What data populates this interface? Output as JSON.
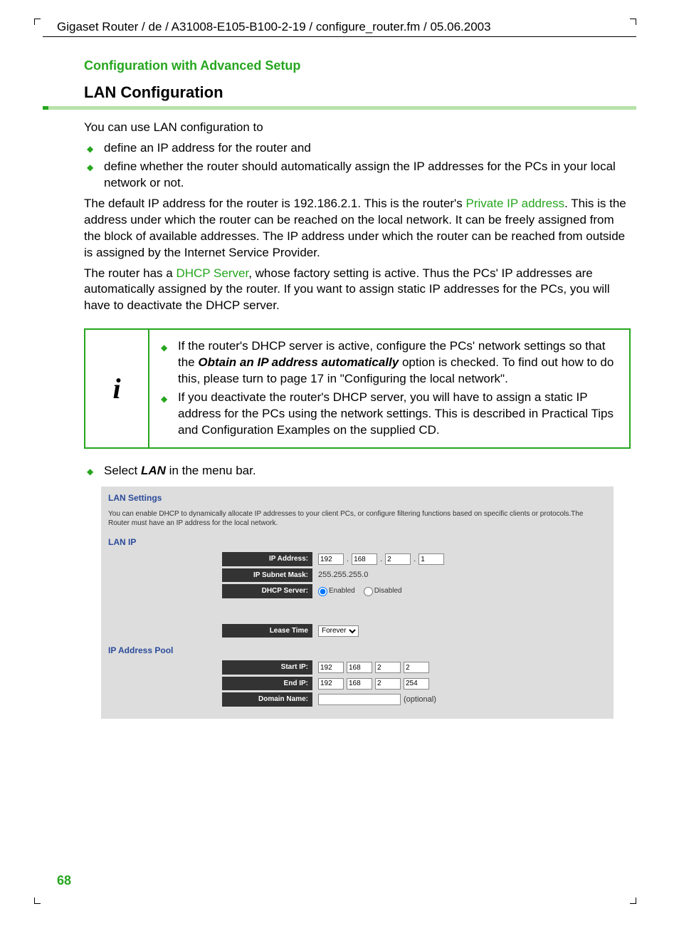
{
  "header_path": "Gigaset Router / de / A31008-E105-B100-2-19 / configure_router.fm / 05.06.2003",
  "chapter": "Configuration with Advanced Setup",
  "section_title": "LAN Configuration",
  "intro": "You can use LAN configuration to",
  "intro_bullets": [
    "define an IP address for the router and",
    "define whether the router should automatically assign the IP addresses for the PCs in your local network or not."
  ],
  "para_default_a": "The default IP address for the router is 192.186.2.1. This is the router's ",
  "link_private_ip": "Private IP address",
  "para_default_b": ". This is the address under which the router can be reached on the local network. It can be freely assigned from the block of available addresses. The IP address under which the router can be reached from outside is assigned by the Internet Service Provider.",
  "para_dhcp_a": "The router has a ",
  "link_dhcp": "DHCP Server",
  "para_dhcp_b": ", whose factory setting is active. Thus the PCs' IP addresses are automatically assigned by the router. If you want to assign static IP addresses for the PCs, you will have to deactivate the DHCP server.",
  "info_icon": "i",
  "info_bullets": {
    "b1_a": "If the router's DHCP server is active, configure the PCs' network settings so that the ",
    "b1_bold": "Obtain an IP address automatically",
    "b1_b": " option is checked. To find out how to do this, please turn to page 17 in \"Configuring the local network\".",
    "b2": "If you deactivate the router's DHCP server, you will have to assign a static IP address for the PCs using the network settings. This is described in Practical Tips and Configuration Examples on the supplied CD."
  },
  "select_lan_a": "Select ",
  "select_lan_bold": "LAN",
  "select_lan_b": " in the menu bar.",
  "ui": {
    "title": "LAN Settings",
    "desc": "You can enable DHCP to dynamically allocate IP addresses to your client PCs, or configure filtering functions based on specific clients or protocols.The Router must have an IP address for the local network.",
    "section_lan_ip": "LAN IP",
    "labels": {
      "ip_address": "IP Address:",
      "subnet": "IP Subnet Mask:",
      "dhcp": "DHCP Server:",
      "lease": "Lease Time",
      "start_ip": "Start IP:",
      "end_ip": "End IP:",
      "domain": "Domain Name:"
    },
    "ip": {
      "o1": "192",
      "o2": "168",
      "o3": "2",
      "o4": "1"
    },
    "subnet_value": "255.255.255.0",
    "dhcp_enabled": "Enabled",
    "dhcp_disabled": "Disabled",
    "lease_value": "Forever",
    "section_pool": "IP Address Pool",
    "start_ip": {
      "o1": "192",
      "o2": "168",
      "o3": "2",
      "o4": "2"
    },
    "end_ip": {
      "o1": "192",
      "o2": "168",
      "o3": "2",
      "o4": "254"
    },
    "domain_value": "",
    "domain_optional": "(optional)"
  },
  "page_number": "68"
}
